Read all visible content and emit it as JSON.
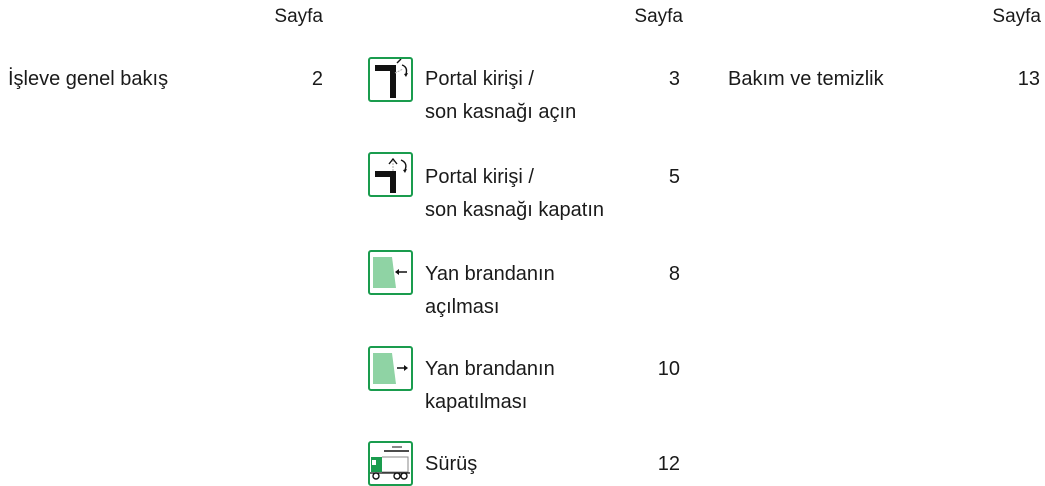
{
  "columns": [
    {
      "header": "Sayfa"
    },
    {
      "header": "Sayfa"
    },
    {
      "header": "Sayfa"
    }
  ],
  "col1": [
    {
      "title": "İşleve genel bakış",
      "page": "2"
    }
  ],
  "col2": [
    {
      "line1": "Portal kirişi /",
      "line2": "son kasnağı açın",
      "page": "3",
      "icon": "portal-open-icon"
    },
    {
      "line1": "Portal kirişi /",
      "line2": "son kasnağı kapatın",
      "page": "5",
      "icon": "portal-close-icon"
    },
    {
      "line1": "Yan brandanın",
      "line2": "açılması",
      "page": "8",
      "icon": "curtain-open-icon"
    },
    {
      "line1": "Yan brandanın",
      "line2": "kapatılması",
      "page": "10",
      "icon": "curtain-close-icon"
    },
    {
      "line1": "Sürüş",
      "line2": "",
      "page": "12",
      "icon": "truck-driving-icon"
    }
  ],
  "col3": [
    {
      "title": "Bakım ve temizlik",
      "page": "13"
    }
  ],
  "colors": {
    "icon_border": "#1a9c4e",
    "icon_fill": "#8fd3a4",
    "text": "#1a1a1a"
  }
}
